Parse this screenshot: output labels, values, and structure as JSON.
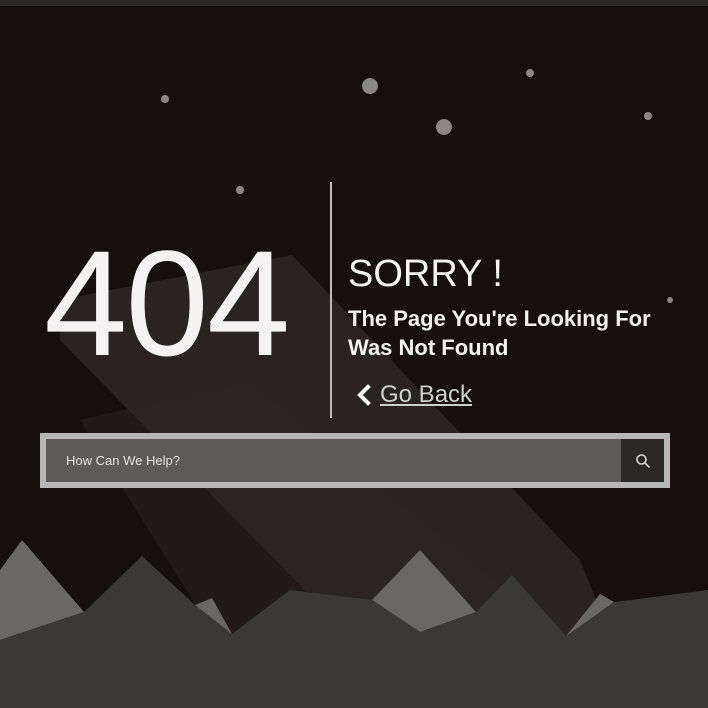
{
  "error": {
    "code": "404",
    "headline": "SORRY !",
    "message": "The Page You're Looking For Was Not Found"
  },
  "nav": {
    "back_label": "Go Back",
    "back_icon": "chevron-left-icon"
  },
  "search": {
    "placeholder": "How Can We Help?",
    "value": "",
    "button_icon": "search-icon"
  },
  "theme": {
    "background": "#150f0f",
    "text": "#f4f2f2",
    "search_bg": "#5e5a5a",
    "search_border": "#b7b7b7",
    "search_button": "#2b2828",
    "mountain_dark": "#3b3838",
    "mountain_light": "#6a6767"
  }
}
